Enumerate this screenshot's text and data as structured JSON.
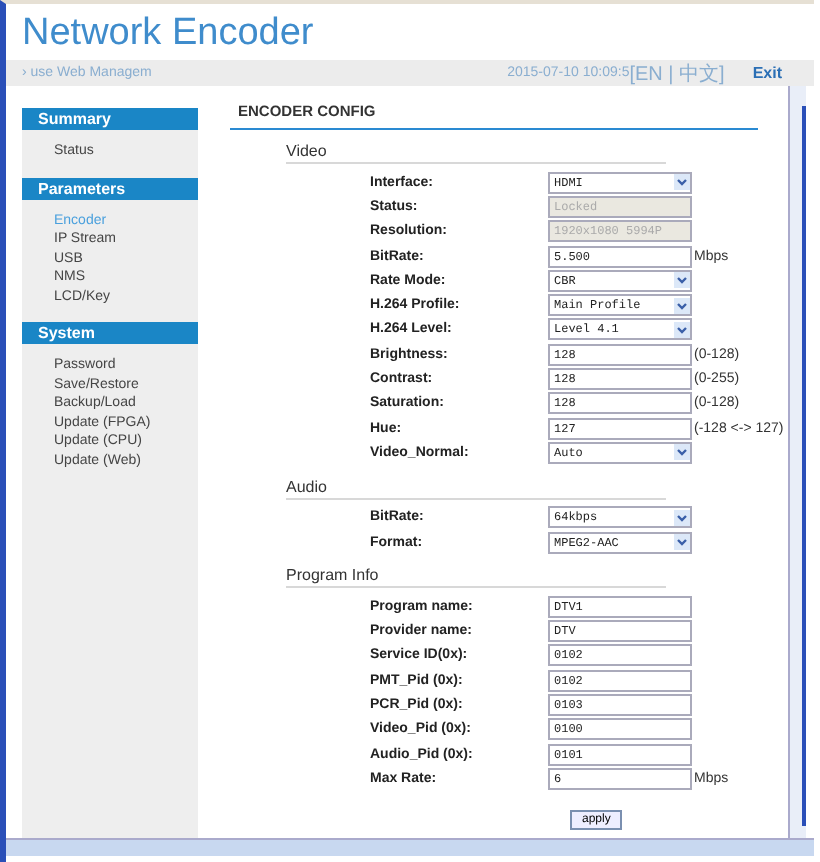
{
  "header": {
    "title": "Network Encoder",
    "marquee": "› use Web Managem",
    "datetime": "2015-07-10 10:09:5",
    "languages": "[EN | 中文]",
    "exit": "Exit"
  },
  "sidebar": [
    {
      "title": "Summary",
      "items": [
        {
          "label": "Status",
          "selected": false
        }
      ]
    },
    {
      "title": "Parameters",
      "items": [
        {
          "label": "Encoder",
          "selected": true
        },
        {
          "label": "IP Stream",
          "selected": false
        },
        {
          "label": "USB",
          "selected": false
        },
        {
          "label": "NMS",
          "selected": false
        },
        {
          "label": "LCD/Key",
          "selected": false
        }
      ]
    },
    {
      "title": "System",
      "items": [
        {
          "label": "Password",
          "selected": false
        },
        {
          "label": "Save/Restore",
          "selected": false
        },
        {
          "label": "Backup/Load",
          "selected": false
        },
        {
          "label": "Update (FPGA)",
          "selected": false
        },
        {
          "label": "Update (CPU)",
          "selected": false
        },
        {
          "label": "Update (Web)",
          "selected": false
        }
      ]
    }
  ],
  "main": {
    "heading": "ENCODER CONFIG",
    "sections": [
      {
        "title": "Video",
        "fields": [
          {
            "label": "Interface:",
            "kind": "select",
            "value": "HDMI"
          },
          {
            "label": "Status:",
            "kind": "readonly",
            "value": "Locked"
          },
          {
            "label": "Resolution:",
            "kind": "readonly",
            "value": "1920x1080 5994P"
          },
          {
            "label": "BitRate:",
            "kind": "text",
            "value": "5.500",
            "unit": "Mbps"
          },
          {
            "label": "Rate Mode:",
            "kind": "select",
            "value": "CBR"
          },
          {
            "label": "H.264 Profile:",
            "kind": "select",
            "value": "Main Profile"
          },
          {
            "label": "H.264 Level:",
            "kind": "select",
            "value": "Level 4.1"
          },
          {
            "label": "Brightness:",
            "kind": "text",
            "value": "128",
            "unit": "(0-128)"
          },
          {
            "label": "Contrast:",
            "kind": "text",
            "value": "128",
            "unit": "(0-255)"
          },
          {
            "label": "Saturation:",
            "kind": "text",
            "value": "128",
            "unit": "(0-128)"
          },
          {
            "label": "Hue:",
            "kind": "text",
            "value": "127",
            "unit": "(-128 <-> 127)"
          },
          {
            "label": "Video_Normal:",
            "kind": "select",
            "value": "Auto"
          }
        ]
      },
      {
        "title": "Audio",
        "fields": [
          {
            "label": "BitRate:",
            "kind": "select",
            "value": "64kbps"
          },
          {
            "label": "Format:",
            "kind": "select",
            "value": "MPEG2-AAC"
          }
        ]
      },
      {
        "title": "Program Info",
        "fields": [
          {
            "label": "Program name:",
            "kind": "text",
            "value": "DTV1"
          },
          {
            "label": "Provider name:",
            "kind": "text",
            "value": "DTV"
          },
          {
            "label": "Service ID(0x):",
            "kind": "text",
            "value": "0102"
          },
          {
            "label": "PMT_Pid (0x):",
            "kind": "text",
            "value": "0102"
          },
          {
            "label": "PCR_Pid (0x):",
            "kind": "text",
            "value": "0103"
          },
          {
            "label": "Video_Pid (0x):",
            "kind": "text",
            "value": "0100"
          },
          {
            "label": "Audio_Pid (0x):",
            "kind": "text",
            "value": "0101"
          },
          {
            "label": "Max Rate:",
            "kind": "text",
            "value": "6",
            "unit": "Mbps"
          }
        ]
      }
    ],
    "apply": "apply"
  }
}
